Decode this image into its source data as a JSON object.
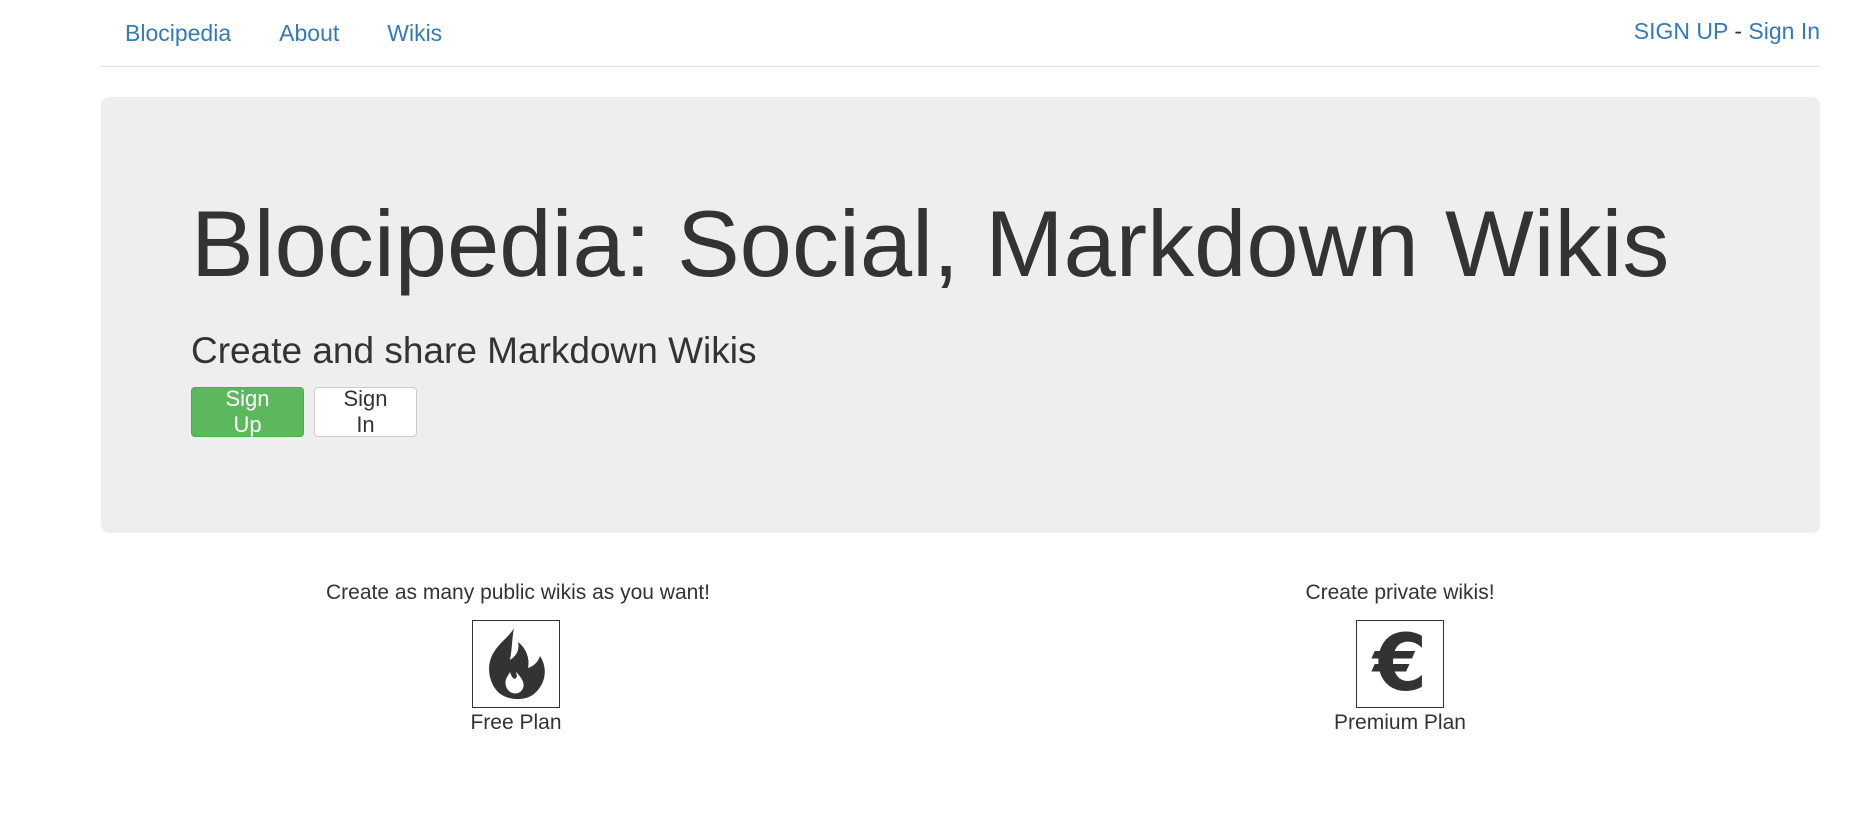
{
  "nav": {
    "links": [
      {
        "label": "Blocipedia"
      },
      {
        "label": "About"
      },
      {
        "label": "Wikis"
      }
    ],
    "signup_label": "SIGN UP",
    "separator": " - ",
    "signin_label": "Sign In"
  },
  "hero": {
    "title": "Blocipedia: Social, Markdown Wikis",
    "subtitle": "Create and share Markdown Wikis",
    "signup_button": "Sign Up",
    "signin_button": "Sign In"
  },
  "features": {
    "free": {
      "text": "Create as many public wikis as you want!",
      "icon": "fire-icon",
      "label": "Free Plan"
    },
    "premium": {
      "text": "Create private wikis!",
      "icon": "euro-icon",
      "label": "Premium Plan"
    }
  },
  "colors": {
    "link": "#337ab7",
    "success": "#5cb85c",
    "jumbotron": "#eeeeee",
    "text": "#333333"
  }
}
